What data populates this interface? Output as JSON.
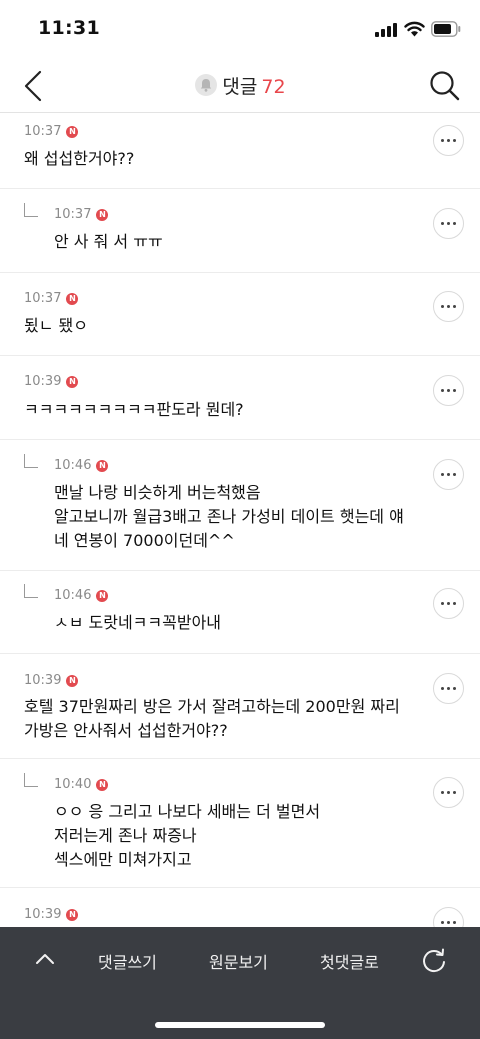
{
  "status": {
    "time": "11:31"
  },
  "nav": {
    "title": "댓글",
    "count": "72"
  },
  "comments": [
    {
      "time": "10:37",
      "badge": "N",
      "text": "왜 섭섭한거야??",
      "reply": false
    },
    {
      "time": "10:37",
      "badge": "N",
      "text": "안 사 줘 서 ㅠㅠ",
      "reply": true
    },
    {
      "time": "10:37",
      "badge": "N",
      "text": "됬ㄴ 됐ㅇ",
      "reply": false
    },
    {
      "time": "10:39",
      "badge": "N",
      "text": "ㅋㅋㅋㅋㅋㅋㅋㅋㅋ판도라 뭔데?",
      "reply": false
    },
    {
      "time": "10:46",
      "badge": "N",
      "text": "맨날 나랑 비슷하게 버는척했음\n알고보니까 월급3배고 존나 가성비 데이트 햇는데 얘\n네 연봉이 7000이던데^^",
      "reply": true
    },
    {
      "time": "10:46",
      "badge": "N",
      "text": "ㅅㅂ 도랏네ㅋㅋ꼭받아내",
      "reply": true
    },
    {
      "time": "10:39",
      "badge": "N",
      "text": "호텔 37만원짜리 방은 가서 잘려고하는데 200만원 짜리\n가방은 안사줘서 섭섭한거야??",
      "reply": false
    },
    {
      "time": "10:40",
      "badge": "N",
      "text": "ㅇㅇ 응 그리고 나보다 세배는 더 벌면서\n저러는게 존나 짜증나\n섹스에만 미쳐가지고",
      "reply": true
    },
    {
      "time": "10:39",
      "badge": "N",
      "text": "",
      "reply": false
    }
  ],
  "bottom": {
    "write": "댓글쓰기",
    "original": "원문보기",
    "first": "첫댓글로"
  },
  "icons": {
    "back": "chevron-left-icon",
    "bell": "bell-icon",
    "search": "search-icon",
    "more": "more-icon",
    "up": "chevron-up-icon",
    "refresh": "refresh-icon"
  },
  "colors": {
    "accent": "#e8464b",
    "bottom_bar": "#3a3d42"
  }
}
